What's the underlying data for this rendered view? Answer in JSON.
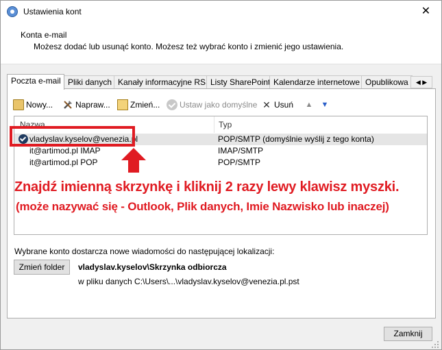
{
  "window": {
    "title": "Ustawienia kont",
    "close_glyph": "✕"
  },
  "header": {
    "title": "Konta e-mail",
    "description": "Możesz dodać lub usunąć konto. Możesz też wybrać konto i zmienić jego ustawienia."
  },
  "tabs": [
    {
      "label": "Poczta e-mail",
      "active": true
    },
    {
      "label": "Pliki danych"
    },
    {
      "label": "Kanały informacyjne RSS"
    },
    {
      "label": "Listy SharePoint"
    },
    {
      "label": "Kalendarze internetowe"
    },
    {
      "label": "Opublikowa"
    }
  ],
  "tab_arrows": "◀ ▶",
  "toolbar": {
    "new_label": "Nowy...",
    "repair_label": "Napraw...",
    "change_label": "Zmień...",
    "set_default_label": "Ustaw jako domyślne",
    "remove_label": "Usuń",
    "remove_glyph": "✕",
    "up_glyph": "▲",
    "down_glyph": "▼"
  },
  "list": {
    "columns": {
      "name": "Nazwa",
      "type": "Typ"
    },
    "rows": [
      {
        "name": "vladyslav.kyselov@venezia.pl",
        "type": "POP/SMTP (domyślnie wyślij z tego konta)",
        "selected": true
      },
      {
        "name": "it@artimod.pl IMAP",
        "type": "IMAP/SMTP"
      },
      {
        "name": "it@artimod.pl POP",
        "type": "POP/SMTP"
      }
    ]
  },
  "annotation": {
    "line1": "Znajdź imienną skrzynkę i kliknij 2 razy lewy klawisz myszki.",
    "line2": "(może nazywać się - Outlook, Plik danych, Imie Nazwisko lub inaczej)",
    "color": "#e01b22"
  },
  "location": {
    "label": "Wybrane konto dostarcza nowe wiadomości do następującej lokalizacji:",
    "change_folder_label": "Zmień folder",
    "folder_name": "vladyslav.kyselov\\Skrzynka odbiorcza",
    "folder_path": "w pliku danych C:\\Users\\...\\vladyslav.kyselov@venezia.pl.pst"
  },
  "footer": {
    "close_label": "Zamknij"
  }
}
